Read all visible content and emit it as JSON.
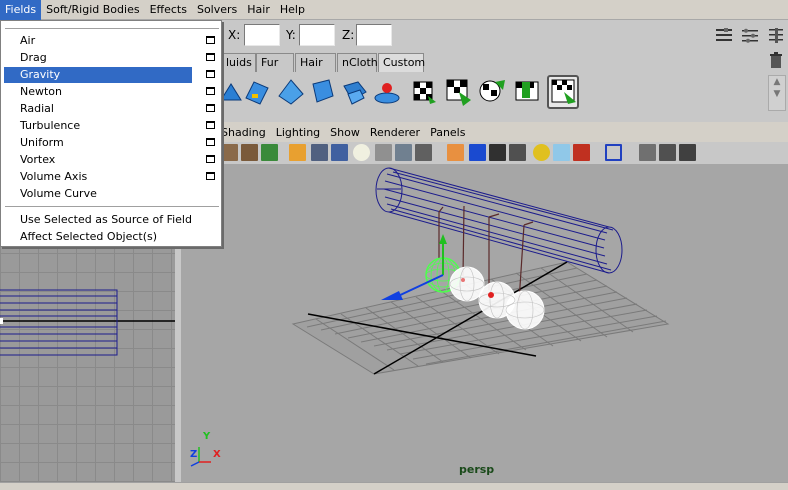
{
  "menubar": {
    "items": [
      "Fields",
      "Soft/Rigid Bodies",
      "Effects",
      "Solvers",
      "Hair",
      "Help"
    ],
    "active": "Fields"
  },
  "statusline": {
    "x_label": "X:",
    "y_label": "Y:",
    "z_label": "Z:",
    "x_value": "",
    "y_value": "",
    "z_value": ""
  },
  "shelf_tabs": [
    "luids",
    "Fur",
    "Hair",
    "nCloth",
    "Custom"
  ],
  "fields_menu": {
    "items": [
      {
        "label": "Air",
        "has_option": true
      },
      {
        "label": "Drag",
        "has_option": true
      },
      {
        "label": "Gravity",
        "has_option": true,
        "highlighted": true
      },
      {
        "label": "Newton",
        "has_option": true
      },
      {
        "label": "Radial",
        "has_option": true
      },
      {
        "label": "Turbulence",
        "has_option": true
      },
      {
        "label": "Uniform",
        "has_option": true
      },
      {
        "label": "Vortex",
        "has_option": true
      },
      {
        "label": "Volume Axis",
        "has_option": true
      },
      {
        "label": "Volume Curve",
        "has_option": false
      }
    ],
    "extra_items": [
      "Use Selected as Source of Field",
      "Affect Selected Object(s)"
    ]
  },
  "panel_menu": [
    "Shading",
    "Lighting",
    "Show",
    "Renderer",
    "Panels"
  ],
  "viewport": {
    "camera_label": "persp"
  },
  "axis": {
    "y": "Y",
    "z": "Z",
    "x": "X"
  },
  "colors": {
    "menu_highlight": "#316ac5",
    "grid": "#808080",
    "cylinder": "#1c1c8c",
    "sphere": "#ffffff",
    "selected_sphere": "#4dff4d"
  }
}
